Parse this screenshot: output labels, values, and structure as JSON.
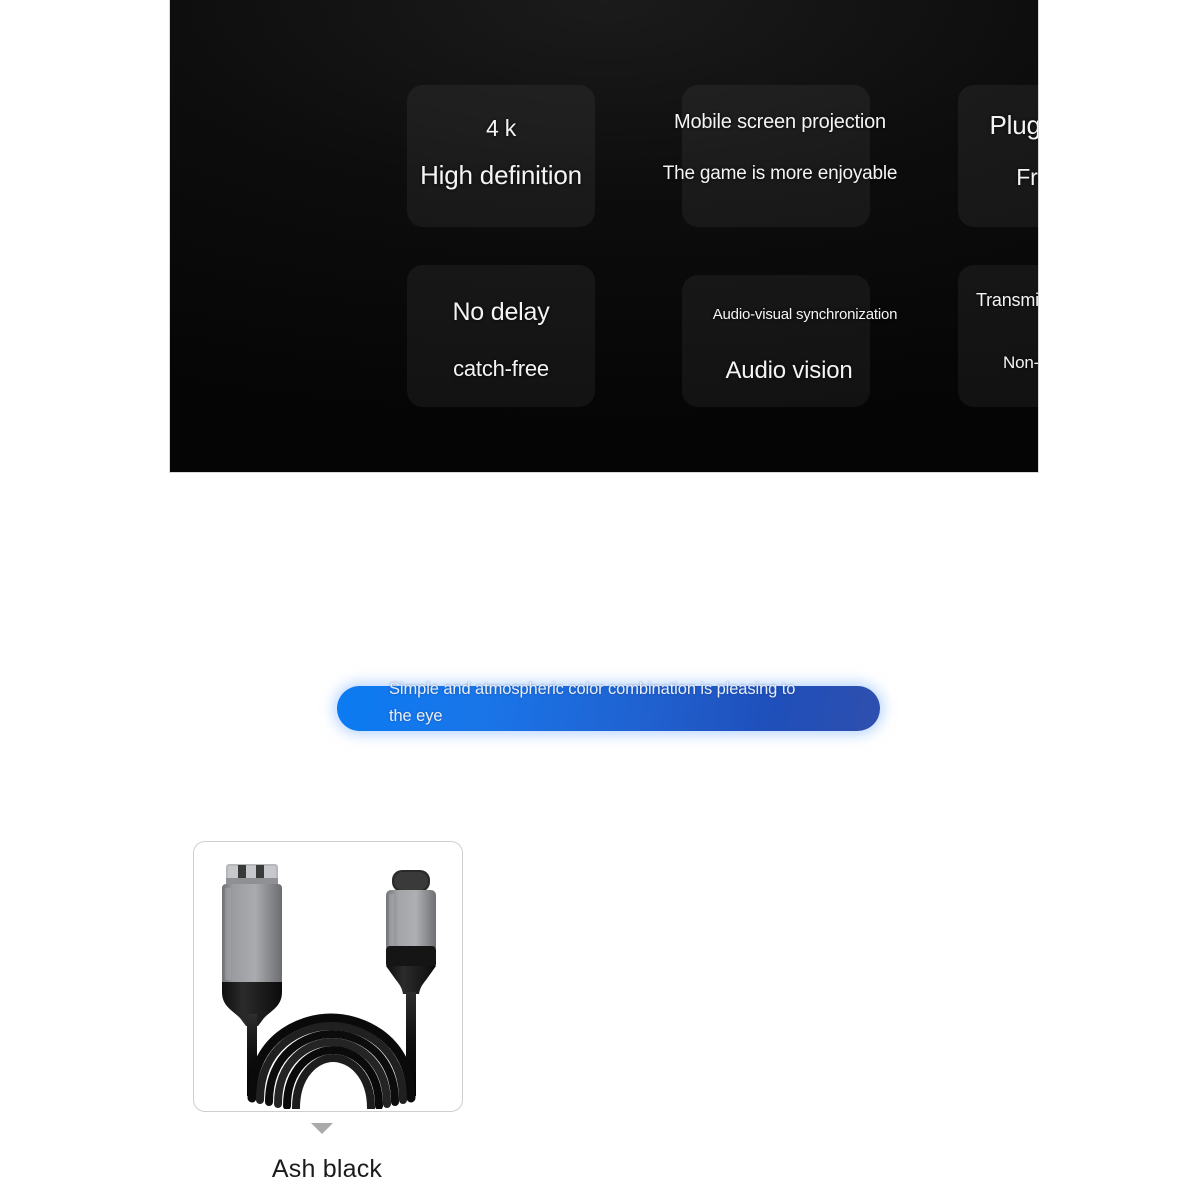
{
  "feature_panel": {
    "background_color": "#0a0a0a",
    "card_color": "#1e1e1e",
    "cells": [
      {
        "title": "4 k",
        "subtitle": "High definition"
      },
      {
        "title": "Mobile screen projection",
        "subtitle": "The game is more enjoyable"
      },
      {
        "title": "Plug and play",
        "subtitle": "Free drive"
      },
      {
        "title": "No delay",
        "subtitle": "catch-free"
      },
      {
        "title": "Audio-visual synchronization",
        "subtitle": "Audio vision"
      },
      {
        "title": "Transmission stability",
        "subtitle": "Non-flashing screen"
      }
    ]
  },
  "banner": {
    "text": "Simple and atmospheric color combination is pleasing to the eye",
    "color_start": "#0b7bf2",
    "color_end": "#2f4fae",
    "text_color": "#e9eef5"
  },
  "product": {
    "swatch_label": "Ash black",
    "caret_icon": "triangle-down-icon",
    "connectors": {
      "left": "hdmi-connector",
      "right": "usb-c-connector"
    },
    "cable_color": "#141414",
    "shell_color": "#8f9194",
    "frame_border_color": "#cfcfcf"
  }
}
